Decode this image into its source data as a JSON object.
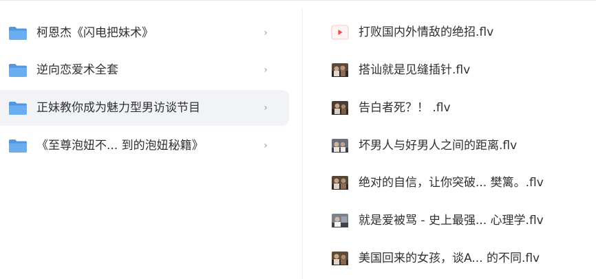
{
  "folders": [
    {
      "name": "柯恩杰《闪电把妹术》",
      "icon": "folder-icon",
      "selected": false
    },
    {
      "name": "逆向恋爱术全套",
      "icon": "folder-icon",
      "selected": false
    },
    {
      "name": "正妹教你成为魅力型男访谈节目",
      "icon": "folder-icon",
      "selected": true
    },
    {
      "name": "《至尊泡妞不... 到的泡妞秘籍》",
      "icon": "folder-icon",
      "selected": false
    }
  ],
  "chevron_glyph": "›",
  "files": [
    {
      "name": "打败国内外情敌的绝招.flv",
      "icon": "video-play-icon"
    },
    {
      "name": "搭讪就是见缝插针.flv",
      "icon": "video-thumbnail-icon"
    },
    {
      "name": "告白者死？！ .flv",
      "icon": "video-thumbnail-icon"
    },
    {
      "name": "坏男人与好男人之间的距离.flv",
      "icon": "video-thumbnail-icon"
    },
    {
      "name": "绝对的自信，让你突破... 樊篱。.flv",
      "icon": "video-thumbnail-icon"
    },
    {
      "name": "就是爱被骂 - 史上最强... 心理学.flv",
      "icon": "video-thumbnail-icon"
    },
    {
      "name": "美国回来的女孩，谈A... 的不同.flv",
      "icon": "video-thumbnail-icon"
    }
  ],
  "colors": {
    "folder": "#6aaef0",
    "folder_tab": "#4f97e3",
    "selected_row": "#f2f3f6",
    "play_icon": "#f04848",
    "text": "#2f3033",
    "chevron": "#9aa0a8"
  }
}
